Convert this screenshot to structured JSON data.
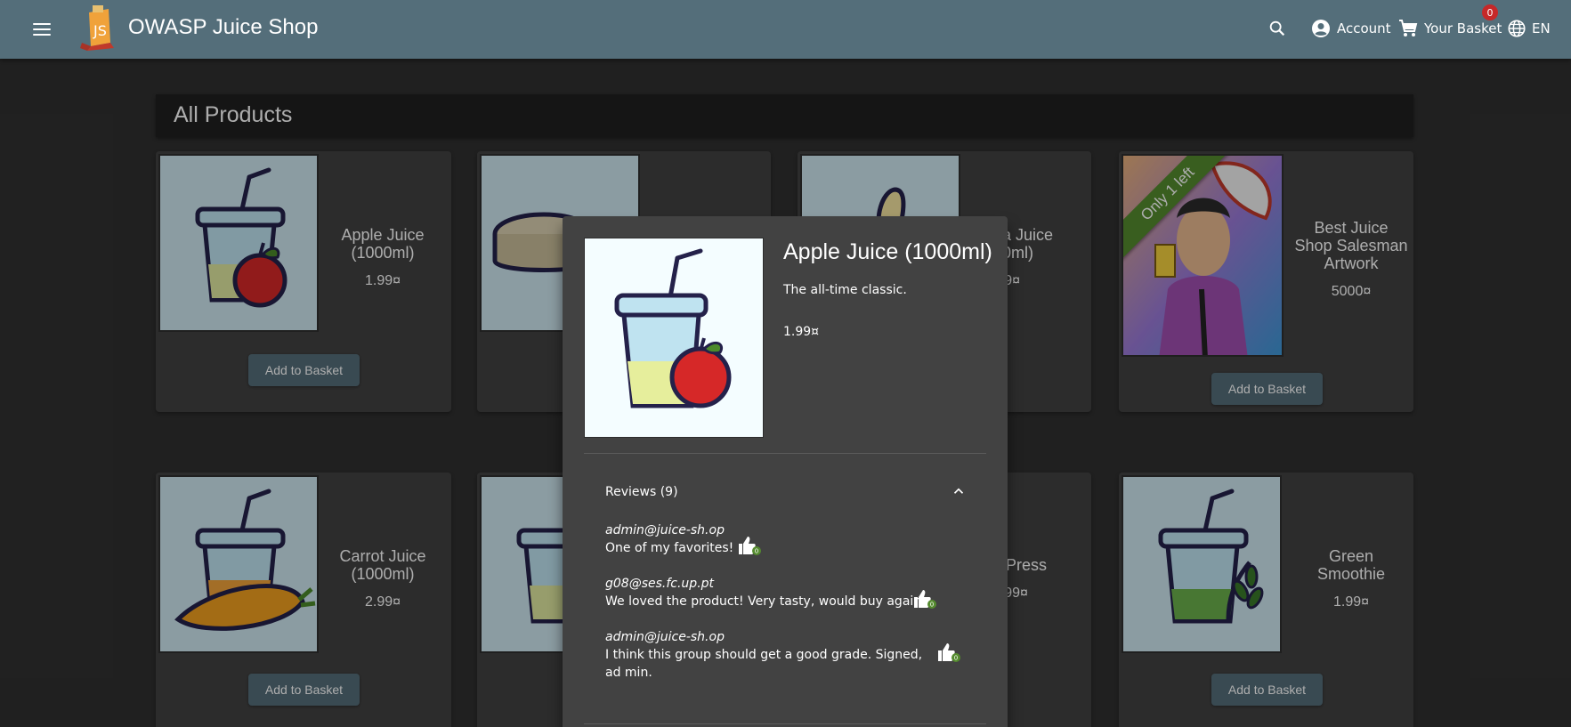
{
  "app": {
    "title": "OWASP Juice Shop",
    "account_label": "Account",
    "basket_label": "Your Basket",
    "basket_count": "0",
    "language_label": "EN"
  },
  "page": {
    "heading": "All Products"
  },
  "products": [
    {
      "name": "Apple Juice (1000ml)",
      "price": "1.99¤",
      "button": "Add to Basket"
    },
    {
      "name": "ana Juice\n000ml)",
      "price": "1.99¤"
    },
    {
      "name": "Best Juice Shop Salesman Artwork",
      "price": "5000¤",
      "button": "Add to Basket",
      "ribbon": "Only 1 left"
    },
    {
      "name": "Carrot Juice (1000ml)",
      "price": "2.99¤",
      "button": "Add to Basket"
    },
    {
      "name": "uit Press",
      "price": "39.99¤"
    },
    {
      "name": "Green Smoothie",
      "price": "1.99¤",
      "button": "Add to Basket"
    }
  ],
  "dialog": {
    "title": "Apple Juice (1000ml)",
    "description": "The all-time classic.",
    "price": "1.99¤",
    "reviews_label": "Reviews (9)",
    "reviews": [
      {
        "author": "admin@juice-sh.op",
        "message": "One of my favorites!",
        "likes": "0"
      },
      {
        "author": "g08@ses.fc.up.pt",
        "message": "We loved the product! Very tasty, would buy again.",
        "likes": "0"
      },
      {
        "author": "admin@juice-sh.op",
        "message": "I think this group should get a good grade. Signed, ad min.",
        "likes": "0"
      }
    ]
  },
  "colors": {
    "toolbar": "#546e7a",
    "background": "#303030",
    "card": "#424242",
    "ribbon": "#558b2f",
    "badge": "#c62828",
    "like_badge": "#558b2f"
  }
}
